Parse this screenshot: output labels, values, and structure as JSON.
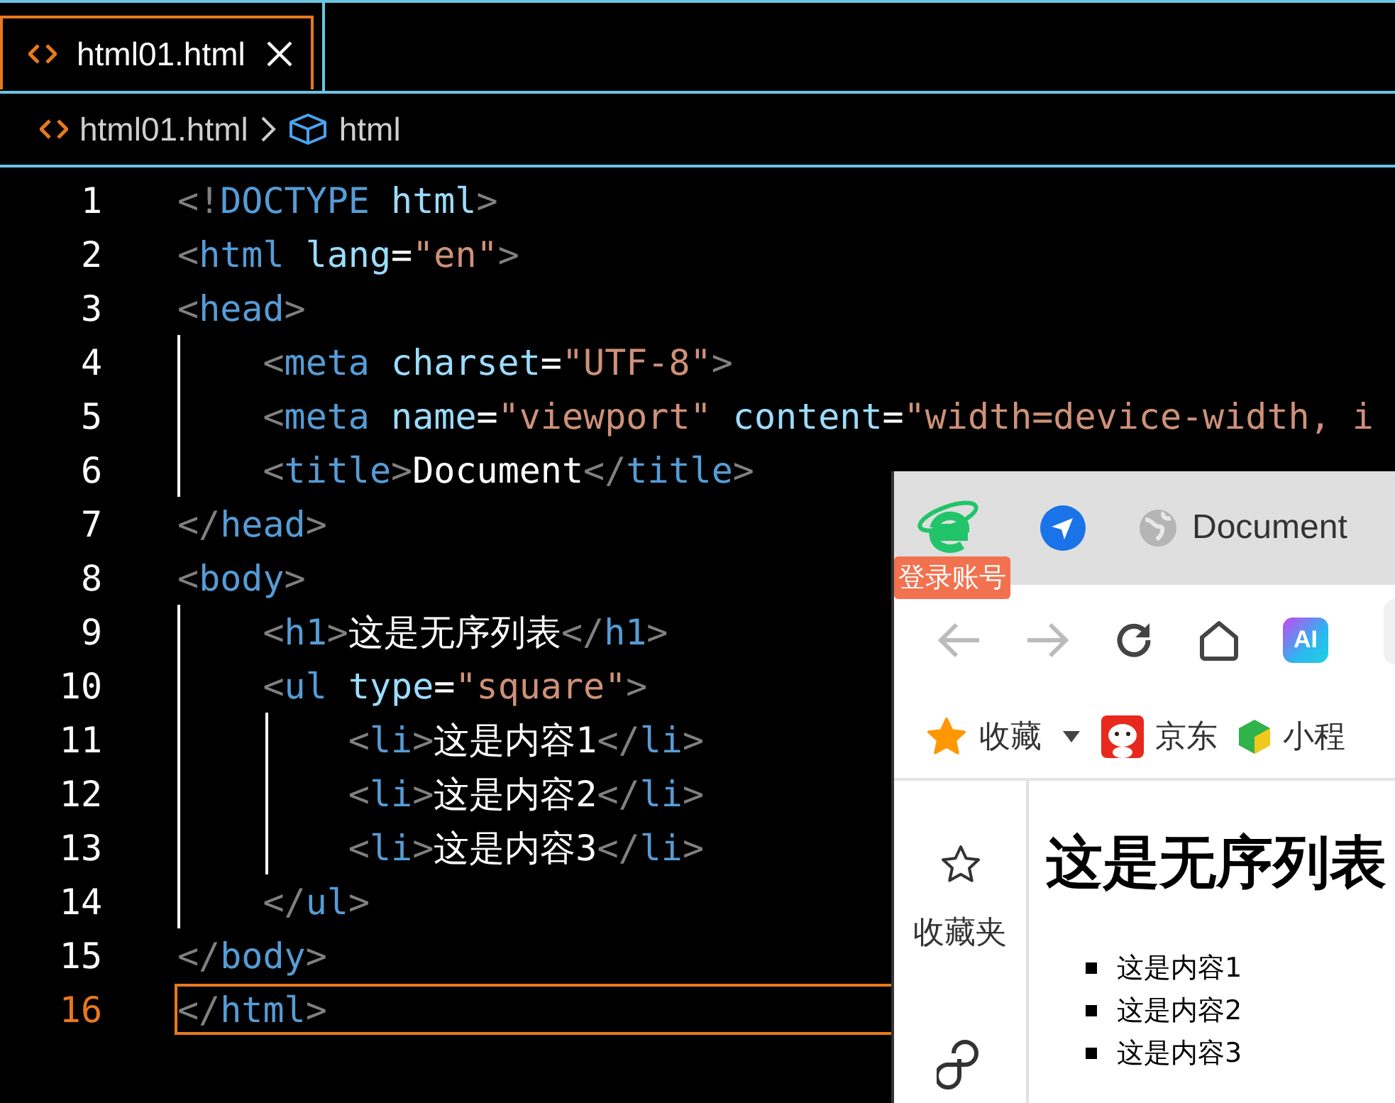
{
  "editor": {
    "tabs": [
      {
        "label": "html01.html",
        "selected": true
      }
    ],
    "breadcrumb": [
      "html01.html",
      "html"
    ],
    "lines": [
      {
        "number": "1",
        "selected": false,
        "tokens": [
          {
            "kind": "punct",
            "text": "<!"
          },
          {
            "kind": "tag",
            "text": "DOCTYPE"
          },
          {
            "kind": "attr",
            "text": " html"
          },
          {
            "kind": "punct",
            "text": ">"
          }
        ]
      },
      {
        "number": "2",
        "selected": false,
        "tokens": [
          {
            "kind": "punct",
            "text": "<"
          },
          {
            "kind": "tag",
            "text": "html"
          },
          {
            "kind": "attr",
            "text": " lang"
          },
          {
            "kind": "text",
            "text": "="
          },
          {
            "kind": "str",
            "text": "\"en\""
          },
          {
            "kind": "punct",
            "text": ">"
          }
        ]
      },
      {
        "number": "3",
        "selected": false,
        "tokens": [
          {
            "kind": "punct",
            "text": "<"
          },
          {
            "kind": "tag",
            "text": "head"
          },
          {
            "kind": "punct",
            "text": ">"
          }
        ],
        "children": [
          {
            "number": "4",
            "selected": false,
            "tokens": [
              {
                "kind": "punct",
                "text": "<"
              },
              {
                "kind": "tag",
                "text": "meta"
              },
              {
                "kind": "attr",
                "text": " charset"
              },
              {
                "kind": "text",
                "text": "="
              },
              {
                "kind": "str",
                "text": "\"UTF-8\""
              },
              {
                "kind": "punct",
                "text": ">"
              }
            ]
          },
          {
            "number": "5",
            "selected": false,
            "tokens": [
              {
                "kind": "punct",
                "text": "<"
              },
              {
                "kind": "tag",
                "text": "meta"
              },
              {
                "kind": "attr",
                "text": " name"
              },
              {
                "kind": "text",
                "text": "="
              },
              {
                "kind": "str",
                "text": "\"viewport\""
              },
              {
                "kind": "attr",
                "text": " content"
              },
              {
                "kind": "text",
                "text": "="
              },
              {
                "kind": "str",
                "text": "\"width=device-width, i"
              }
            ]
          },
          {
            "number": "6",
            "selected": false,
            "tokens": [
              {
                "kind": "punct",
                "text": "<"
              },
              {
                "kind": "tag",
                "text": "title"
              },
              {
                "kind": "punct",
                "text": ">"
              },
              {
                "kind": "text",
                "text": "Document"
              },
              {
                "kind": "punct",
                "text": "</"
              },
              {
                "kind": "tag",
                "text": "title"
              },
              {
                "kind": "punct",
                "text": ">"
              }
            ]
          }
        ]
      },
      {
        "number": "7",
        "selected": false,
        "tokens": [
          {
            "kind": "punct",
            "text": "</"
          },
          {
            "kind": "tag",
            "text": "head"
          },
          {
            "kind": "punct",
            "text": ">"
          }
        ]
      },
      {
        "number": "8",
        "selected": false,
        "tokens": [
          {
            "kind": "punct",
            "text": "<"
          },
          {
            "kind": "tag",
            "text": "body"
          },
          {
            "kind": "punct",
            "text": ">"
          }
        ],
        "children": [
          {
            "number": "9",
            "selected": false,
            "tokens": [
              {
                "kind": "punct",
                "text": "<"
              },
              {
                "kind": "tag",
                "text": "h1"
              },
              {
                "kind": "punct",
                "text": ">"
              },
              {
                "kind": "text",
                "text": "这是无序列表"
              },
              {
                "kind": "punct",
                "text": "</"
              },
              {
                "kind": "tag",
                "text": "h1"
              },
              {
                "kind": "punct",
                "text": ">"
              }
            ]
          },
          {
            "number": "10",
            "selected": false,
            "tokens": [
              {
                "kind": "punct",
                "text": "<"
              },
              {
                "kind": "tag",
                "text": "ul"
              },
              {
                "kind": "attr",
                "text": " type"
              },
              {
                "kind": "text",
                "text": "="
              },
              {
                "kind": "str",
                "text": "\"square\""
              },
              {
                "kind": "punct",
                "text": ">"
              }
            ],
            "children": [
              {
                "number": "11",
                "selected": false,
                "tokens": [
                  {
                    "kind": "punct",
                    "text": "<"
                  },
                  {
                    "kind": "tag",
                    "text": "li"
                  },
                  {
                    "kind": "punct",
                    "text": ">"
                  },
                  {
                    "kind": "text",
                    "text": "这是内容1"
                  },
                  {
                    "kind": "punct",
                    "text": "</"
                  },
                  {
                    "kind": "tag",
                    "text": "li"
                  },
                  {
                    "kind": "punct",
                    "text": ">"
                  }
                ]
              },
              {
                "number": "12",
                "selected": false,
                "tokens": [
                  {
                    "kind": "punct",
                    "text": "<"
                  },
                  {
                    "kind": "tag",
                    "text": "li"
                  },
                  {
                    "kind": "punct",
                    "text": ">"
                  },
                  {
                    "kind": "text",
                    "text": "这是内容2"
                  },
                  {
                    "kind": "punct",
                    "text": "</"
                  },
                  {
                    "kind": "tag",
                    "text": "li"
                  },
                  {
                    "kind": "punct",
                    "text": ">"
                  }
                ]
              },
              {
                "number": "13",
                "selected": false,
                "tokens": [
                  {
                    "kind": "punct",
                    "text": "<"
                  },
                  {
                    "kind": "tag",
                    "text": "li"
                  },
                  {
                    "kind": "punct",
                    "text": ">"
                  },
                  {
                    "kind": "text",
                    "text": "这是内容3"
                  },
                  {
                    "kind": "punct",
                    "text": "</"
                  },
                  {
                    "kind": "tag",
                    "text": "li"
                  },
                  {
                    "kind": "punct",
                    "text": ">"
                  }
                ]
              }
            ]
          },
          {
            "number": "14",
            "selected": false,
            "tokens": [
              {
                "kind": "punct",
                "text": "</"
              },
              {
                "kind": "tag",
                "text": "ul"
              },
              {
                "kind": "punct",
                "text": ">"
              }
            ]
          }
        ]
      },
      {
        "number": "15",
        "selected": false,
        "tokens": [
          {
            "kind": "punct",
            "text": "</"
          },
          {
            "kind": "tag",
            "text": "body"
          },
          {
            "kind": "punct",
            "text": ">"
          }
        ]
      },
      {
        "number": "16",
        "selected": true,
        "tokens": [
          {
            "kind": "punct",
            "text": "</"
          },
          {
            "kind": "tag",
            "text": "html"
          },
          {
            "kind": "punct",
            "text": ">"
          }
        ]
      }
    ]
  },
  "browser": {
    "login_badge": "登录账号",
    "tab_title": "Document",
    "ai_button": "AI",
    "bookmarks": [
      {
        "label": "收藏",
        "kind": "star",
        "dropdown": true
      },
      {
        "label": "京东",
        "kind": "jd",
        "dropdown": false
      },
      {
        "label": "小程",
        "kind": "mini",
        "dropdown": false
      }
    ],
    "sidebar": {
      "label": "收藏夹"
    },
    "page": {
      "heading": "这是无序列表",
      "items": [
        "这是内容1",
        "这是内容2",
        "这是内容3"
      ]
    }
  }
}
